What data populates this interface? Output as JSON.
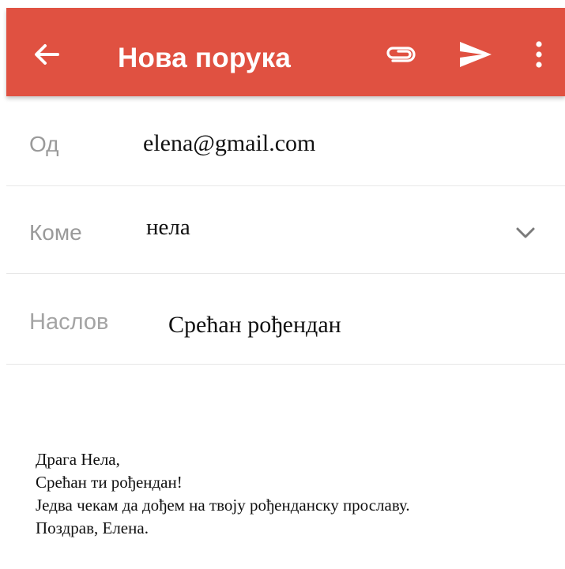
{
  "appbar": {
    "title": "Нова порука",
    "background_color": "#e05141",
    "icons": {
      "back": "arrow-left-icon",
      "attach": "paperclip-icon",
      "send": "send-icon",
      "more": "more-vertical-icon"
    }
  },
  "fields": {
    "from": {
      "label": "Од",
      "value": "elena@gmail.com"
    },
    "to": {
      "label": "Коме",
      "value": "нела",
      "expand_icon": "chevron-down-icon"
    },
    "subject": {
      "label": "Наслов",
      "value": "Срећан рођендан"
    }
  },
  "body": {
    "lines": [
      "Драга Нела,",
      "Срећан ти рођендан!",
      "Једва чекам да дођем на твоју рођенданску прославу.",
      "Поздрав, Елена."
    ]
  }
}
